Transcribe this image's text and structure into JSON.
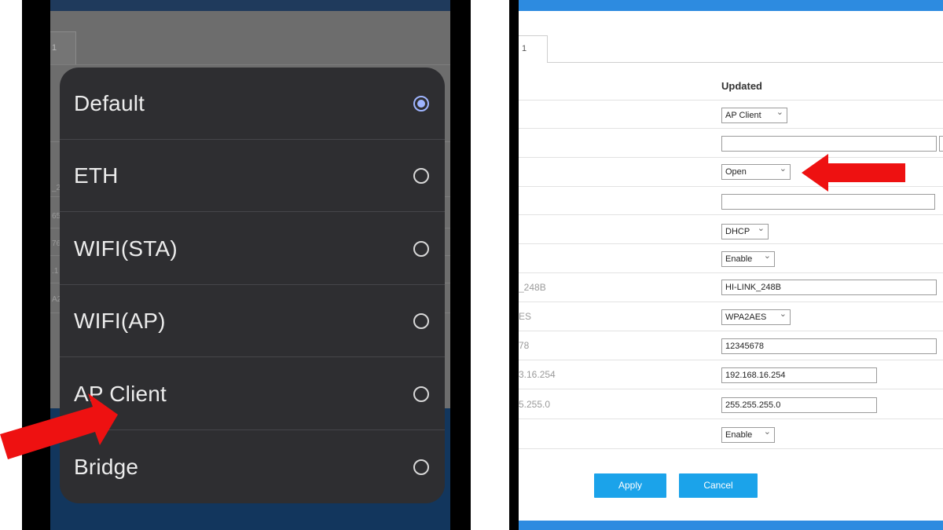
{
  "left": {
    "background_tab_label": "1",
    "background_fragments": [
      "_2",
      "65",
      "76",
      ".1",
      "A2"
    ],
    "menu_options": [
      {
        "label": "Default",
        "selected": true
      },
      {
        "label": "ETH",
        "selected": false
      },
      {
        "label": "WIFI(STA)",
        "selected": false
      },
      {
        "label": "WIFI(AP)",
        "selected": false
      },
      {
        "label": "AP Client",
        "selected": false
      },
      {
        "label": "Bridge",
        "selected": false
      }
    ],
    "arrow_color": "#ee1111",
    "radio_selected_color": "#9fb5ff"
  },
  "right": {
    "tab_label": "1",
    "column_header": "Updated",
    "old_values": {
      "ssid": "_248B",
      "encryption": "ES",
      "password": "78",
      "ip": "3.16.254",
      "mask": "5.255.0"
    },
    "fields": {
      "mode_select": "AP Client",
      "field_2_value": "",
      "encryption_type_select": "Open",
      "field_4_value": "",
      "addressing_select": "DHCP",
      "enable_select_1": "Enable",
      "ssid_input": "HI-LINK_248B",
      "encryption_select": "WPA2AES",
      "password_input": "12345678",
      "ip_input": "192.168.16.254",
      "mask_input": "255.255.255.0",
      "enable_select_2": "Enable"
    },
    "buttons": {
      "apply": "Apply",
      "cancel": "Cancel"
    },
    "accent_color": "#2d8be0",
    "button_color": "#1ba3ea"
  }
}
